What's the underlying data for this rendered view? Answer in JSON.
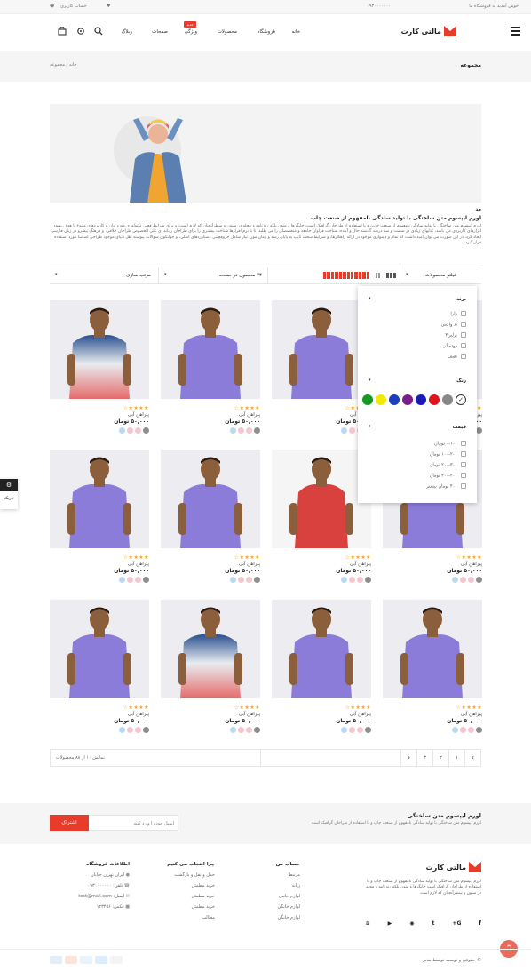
{
  "topbar": {
    "welcome": "خوش آمدید به فروشگاه ما",
    "phone": "۰۹۳۰۰۰۰۰۰۰",
    "account": "حساب کاربری"
  },
  "header": {
    "logo_text": "مالتی کارت",
    "menu": [
      "خانه",
      "فروشگاه",
      "محصولات",
      "ویژگی",
      "صفحات",
      "وبلاگ"
    ],
    "new_badge": "جدید"
  },
  "breadcrumb": {
    "page_title": "مجموعه",
    "home": "خانه",
    "current": "مجموعه"
  },
  "description": {
    "small": "مد",
    "title": "لورم ایپسوم متن ساختگی با تولید سادگی نامفهوم از صنعت چاپ",
    "body": "لورم ایپسوم متن ساختگی با تولید سادگی نامفهوم از صنعت چاپ، و با استفاده از طراحان گرافیک است، چاپگرها و متون بلکه روزنامه و مجله در ستون و سطرآنچنان که لازم است، و برای شرایط فعلی تکنولوژی مورد نیاز، و کاربردهای متنوع با هدف بهبود ابزارهای کاربردی می باشد، کتابهای زیادی در شصت و سه درصد گذشته حال و آینده، شناخت فراوان جامعه و متخصصان را می طلبد، تا با نرم افزارها شناخت بیشتری را برای طراحان رایانه ای علی الخصوص طراحان خلاقی، و فرهنگ پیشرو در زبان فارسی ایجاد کرد، در این صورت می توان امید داشت که تمام و دشواری موجود در ارائه راهکارها، و شرایط سخت تایپ به پایان رسد و زمان مورد نیاز شامل حروفچینی دستاوردهای اصلی، و جوابگوی سوالات پیوسته اهل دنیای موجود طراحی اساسا مورد استفاده قرار گیرد."
  },
  "toolbar": {
    "filter_label": "فیلتر محصولات",
    "per_page": "۲۴ محصول در صفحه",
    "sort": "مرتب سازی"
  },
  "filter_panel": {
    "brand_title": "برند",
    "brands": [
      "زارا",
      "بد واکس",
      "برلین۳",
      "رودمگر",
      "نصف"
    ],
    "color_title": "رنگ",
    "colors": [
      "#ffffff",
      "#888888",
      "#e1141e",
      "#1a1ab8",
      "#7a1f8c",
      "#1b3fb8",
      "#f2ea00",
      "#139b21"
    ],
    "price_title": "قیمت",
    "prices": [
      "۰-۱۰۰ تومان",
      "۱۰۰-۲۰۰ تومان",
      "۲۰۰-۳۰۰ تومان",
      "۳۰۰-۴۰۰ تومان",
      "۴۰۰ تومان بیشتر"
    ]
  },
  "products": [
    {
      "name": "پیراهن آبی",
      "price": "۵۰,۰۰۰ تومان",
      "stars": "★★★★☆",
      "shirt": "ombre"
    },
    {
      "name": "پیراهن آبی",
      "price": "۵۰,۰۰۰ تومان",
      "stars": "★★★★☆",
      "shirt": "purple"
    },
    {
      "name": "پیراهن آبی",
      "price": "۵۰,۰۰۰ تومان",
      "stars": "★★★★☆",
      "shirt": "purple"
    },
    {
      "name": "پیراهن آبی",
      "price": "۵۰,۰۰۰ تومان",
      "stars": "★★★★☆",
      "shirt": "purple"
    },
    {
      "name": "پیراهن آبی",
      "price": "۵۰,۰۰۰ تومان",
      "stars": "★★★★☆",
      "shirt": "purple"
    },
    {
      "name": "پیراهن آبی",
      "price": "۵۰,۰۰۰ تومان",
      "stars": "★★★★☆",
      "shirt": "purple"
    },
    {
      "name": "پیراهن آبی",
      "price": "۵۰,۰۰۰ تومان",
      "stars": "★★★★☆",
      "shirt": "red"
    },
    {
      "name": "پیراهن آبی",
      "price": "۵۰,۰۰۰ تومان",
      "stars": "★★★★☆",
      "shirt": "purple"
    },
    {
      "name": "پیراهن آبی",
      "price": "۵۰,۰۰۰ تومان",
      "stars": "★★★★☆",
      "shirt": "purple"
    },
    {
      "name": "پیراهن آبی",
      "price": "۵۰,۰۰۰ تومان",
      "stars": "★★★★☆",
      "shirt": "ombre"
    },
    {
      "name": "پیراهن آبی",
      "price": "۵۰,۰۰۰ تومان",
      "stars": "★★★★☆",
      "shirt": "purple"
    },
    {
      "name": "پیراهن آبی",
      "price": "۵۰,۰۰۰ تومان",
      "stars": "★★★★☆",
      "shirt": "purple"
    }
  ],
  "swatch_colors": [
    "#8e8e8e",
    "#f4c6d0",
    "#f4c6d0",
    "#bcd9f2"
  ],
  "pagination": {
    "showing": "نمایش ۱۰ از ۸۸ محصولات",
    "pages": [
      "۱",
      "۲",
      "۳"
    ],
    "prev": "‹",
    "next": "›"
  },
  "side_widget": {
    "label": "تاریک"
  },
  "newsletter": {
    "title": "لورم ایپسوم متن ساختگی",
    "text": "لورم ایپسوم متن ساختگی با تولید سادگی نامفهوم از صنعت چاپ و با استفاده از طراحان گرافیک است",
    "placeholder": "ایمیل خود را وارد کنید",
    "button": "اشتراک"
  },
  "footer": {
    "about_logo": "مالتی کارت",
    "about_text": "لورم ایپسوم متن ساختگی با تولید سادگی نامفهوم از صنعت چاپ و با استفاده از طراحان گرافیک است چاپگرها و متون بلکه روزنامه و مجله در ستون و سطرآنچنان که لازم است",
    "account_title": "حساب من",
    "account_links": [
      "مرتبط",
      "زنانه",
      "لوازم جانبی",
      "لوازم خانگی",
      "لوازم خانگی"
    ],
    "why_title": "چرا انتخاب می کنیم",
    "why_links": [
      "حمل و نقل و بازگشت",
      "خرید مطمئن",
      "خرید مطمئن",
      "خرید مطمئن",
      "مطالب"
    ],
    "contact_title": "اطلاعات فروشگاه",
    "contact_lines": [
      "ایران تهران خیابان",
      "تلفن: ۰۹۳۰۰۰۰۰۰۰",
      "ایمیل: test@mail.com",
      "فکس: ۱۲۳۴۵۶"
    ],
    "copyright": "© حقوقی و توسعه توسط مدیر"
  }
}
